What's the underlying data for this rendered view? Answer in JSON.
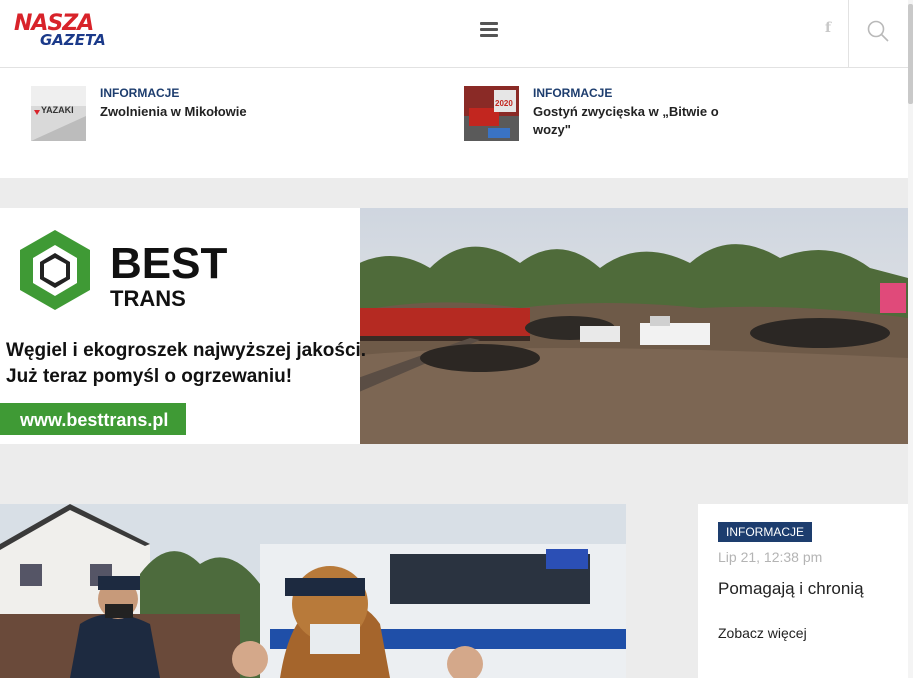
{
  "header": {
    "logo_line1": "NASZA",
    "logo_line2": "GAZETA",
    "menu_icon": "menu-icon",
    "social_icon": "facebook-icon",
    "social_glyph": "f",
    "search_icon": "search-icon"
  },
  "ticker": {
    "items": [
      {
        "category": "INFORMACJE",
        "title": "Zwolnienia w Mikołowie",
        "thumb_text": "YAZAKI"
      },
      {
        "category": "INFORMACJE",
        "title": "Gostyń zwycięska w „Bitwie o wozy\"",
        "thumb_text": "2020"
      }
    ]
  },
  "banner": {
    "brand": "BEST",
    "brand_sub": "TRANS",
    "tagline1": "Węgiel i ekogroszek najwyższej jakości.",
    "tagline2": "Już teraz pomyśl o ogrzewaniu!",
    "url": "www.besttrans.pl"
  },
  "featured": {
    "category": "INFORMACJE",
    "date": "Lip 21, 12:38 pm",
    "title": "Pomagają i chronią",
    "more": "Zobacz więcej"
  },
  "colors": {
    "accent": "#1d3d6e",
    "logo_red": "#d8232a",
    "logo_blue": "#1b3a8a",
    "banner_green": "#3f9a35"
  }
}
